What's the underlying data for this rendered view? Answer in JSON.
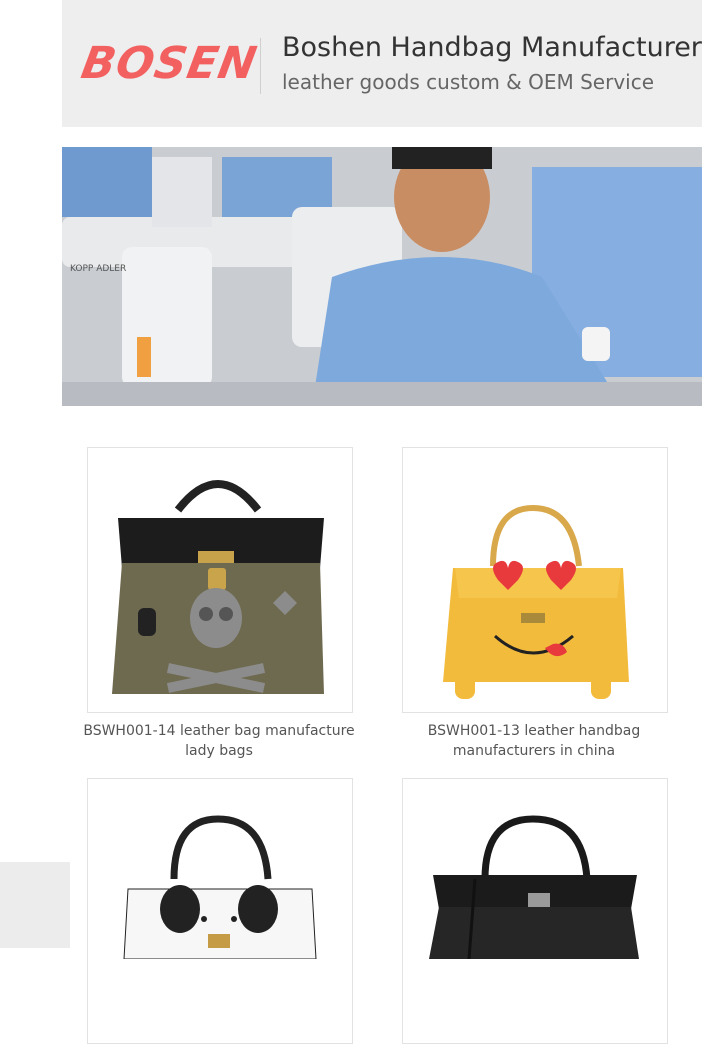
{
  "header": {
    "logo_text": "BOSEN",
    "title": "Boshen Handbag Manufacturer",
    "subtitle": "leather goods custom & OEM Service",
    "accent_color": "#f26060"
  },
  "hero": {
    "description": "factory-worker-sewing-photo",
    "machine_label": "KOPP ADLER"
  },
  "products": [
    {
      "caption": "BSWH001-14 leather bag manufacture lady bags"
    },
    {
      "caption": "BSWH001-13 leather handbag manufacturers in china"
    },
    {
      "caption": ""
    },
    {
      "caption": ""
    }
  ]
}
